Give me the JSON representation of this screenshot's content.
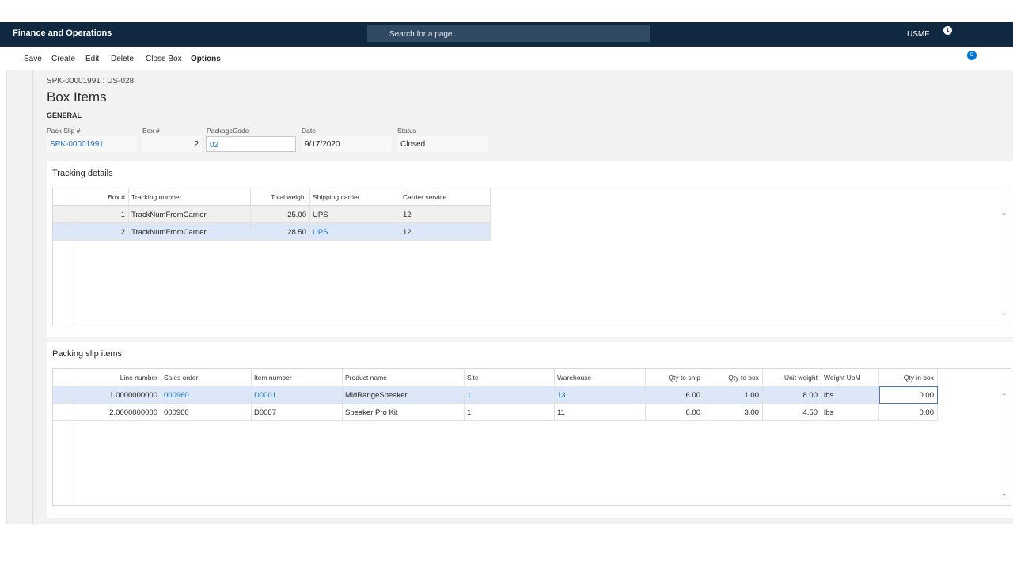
{
  "nav": {
    "app_title": "Finance and Operations",
    "search_placeholder": "Search for a page",
    "company": "USMF",
    "notifications": "1"
  },
  "actions": {
    "save": "Save",
    "create": "Create",
    "edit": "Edit",
    "delete": "Delete",
    "close_box": "Close Box",
    "options": "Options",
    "badge": "0"
  },
  "header": {
    "caption": "SPK-00001991 : US-028",
    "title": "Box Items",
    "group": "GENERAL"
  },
  "fields": {
    "pack_slip_label": "Pack Slip #",
    "pack_slip_value": "SPK-00001991",
    "box_label": "Box #",
    "box_value": "2",
    "package_code_label": "PackageCode",
    "package_code_value": "02",
    "date_label": "Date",
    "date_value": "9/17/2020",
    "status_label": "Status",
    "status_value": "Closed"
  },
  "tracking": {
    "title": "Tracking details",
    "columns": [
      "Box #",
      "Tracking number",
      "Total weight",
      "Shipping carrier",
      "Carrier service"
    ],
    "rows": [
      [
        "1",
        "TrackNumFromCarrier",
        "25.00",
        "UPS",
        "12"
      ],
      [
        "2",
        "TrackNumFromCarrier",
        "28.50",
        "UPS",
        "12"
      ]
    ]
  },
  "packing": {
    "title": "Packing slip items",
    "columns": [
      "Line number",
      "Sales order",
      "Item number",
      "Product name",
      "Site",
      "Warehouse",
      "Qty to ship",
      "Qty to box",
      "Unit weight",
      "Weight UoM",
      "Qty in box"
    ],
    "rows": [
      [
        "1.0000000000",
        "000960",
        "D0001",
        "MidRangeSpeaker",
        "1",
        "13",
        "6.00",
        "1.00",
        "8.00",
        "lbs",
        "0.00"
      ],
      [
        "2.0000000000",
        "000960",
        "D0007",
        "Speaker Pro Kit",
        "1",
        "11",
        "6.00",
        "3.00",
        "4.50",
        "lbs",
        "0.00"
      ]
    ]
  }
}
